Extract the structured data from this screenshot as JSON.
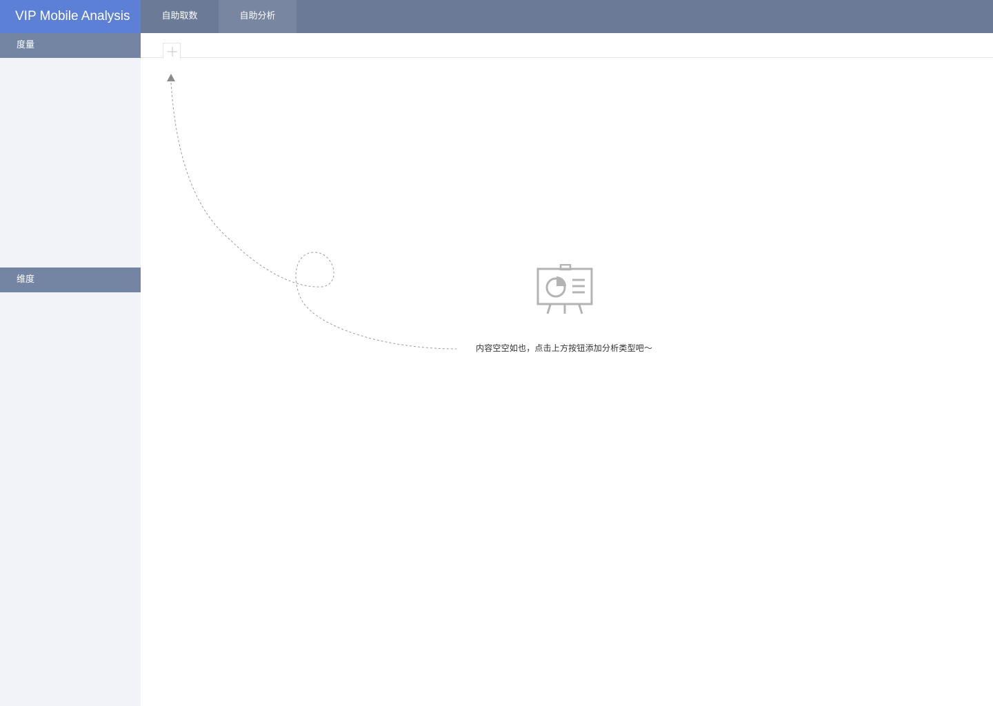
{
  "app": {
    "title": "VIP Mobile Analysis"
  },
  "header": {
    "tabs": [
      {
        "label": "自助取数",
        "active": false
      },
      {
        "label": "自助分析",
        "active": true
      }
    ]
  },
  "sidebar": {
    "sections": [
      {
        "label": "度量"
      },
      {
        "label": "维度"
      }
    ]
  },
  "main": {
    "add_tab_icon": "plus-icon",
    "empty_state": {
      "icon": "presentation-board-icon",
      "message": "内容空空如也，点击上方按钮添加分析类型吧～"
    }
  },
  "colors": {
    "brand": "#5b80d6",
    "topbar": "#6b7a96",
    "active_tab": "#7886a2",
    "sidebar_header": "#7485a3",
    "sidebar_bg": "#f2f3f9"
  }
}
